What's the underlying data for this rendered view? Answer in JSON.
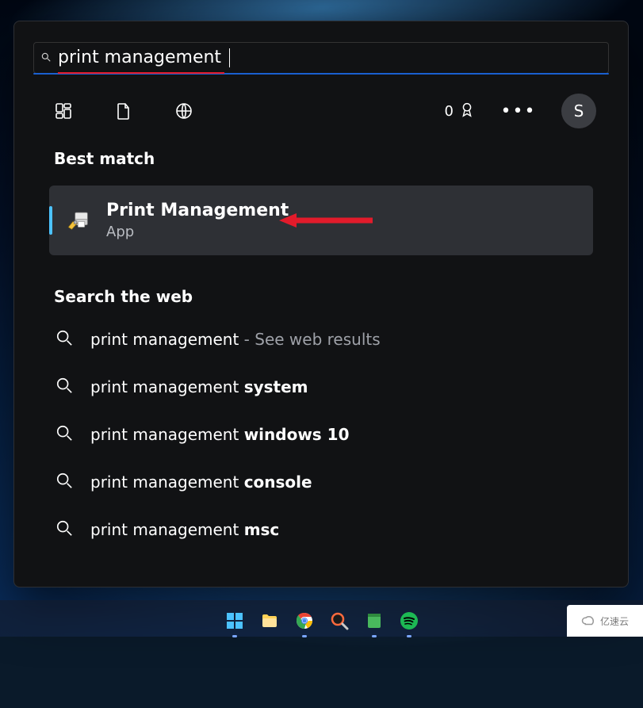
{
  "search": {
    "query": "print management"
  },
  "points": {
    "value": "0"
  },
  "avatar": {
    "initial": "S"
  },
  "best_match": {
    "heading": "Best match",
    "title": "Print Management",
    "subtitle": "App"
  },
  "web": {
    "heading": "Search the web",
    "items": [
      {
        "prefix": "print management",
        "bold": "",
        "suffix": " - See web results"
      },
      {
        "prefix": "print management ",
        "bold": "system",
        "suffix": ""
      },
      {
        "prefix": "print management ",
        "bold": "windows 10",
        "suffix": ""
      },
      {
        "prefix": "print management ",
        "bold": "console",
        "suffix": ""
      },
      {
        "prefix": "print management ",
        "bold": "msc",
        "suffix": ""
      }
    ]
  },
  "watermark": {
    "text": "亿速云"
  }
}
